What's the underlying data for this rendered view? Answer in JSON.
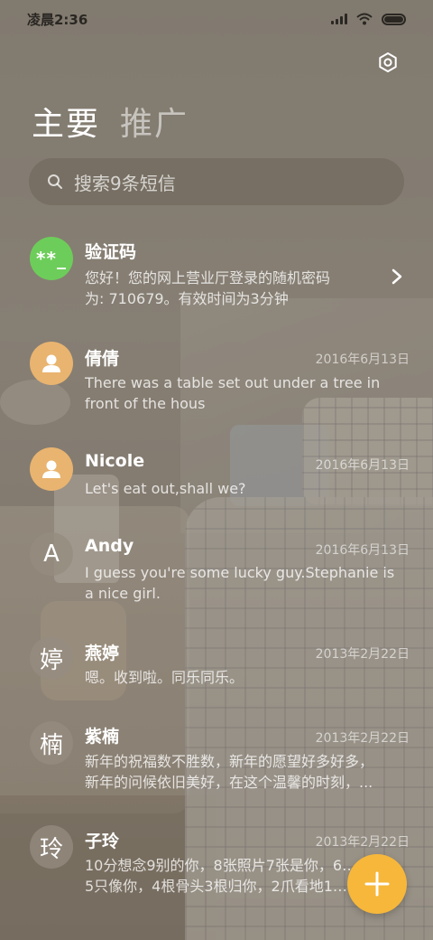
{
  "status_bar": {
    "time": "凌晨2:36"
  },
  "tabs": [
    {
      "label": "主要",
      "active": true
    },
    {
      "label": "推广",
      "active": false
    }
  ],
  "search": {
    "placeholder": "搜索9条短信"
  },
  "messages": [
    {
      "sender": "验证码",
      "avatar": "**_",
      "avatar_color": "#6dcd5a",
      "date": "",
      "preview_line1": "您好！您的网上营业厅登录的随机密码",
      "preview_line2": "为: 710679。有效时间为3分钟"
    },
    {
      "sender": "倩倩",
      "avatar": "person-icon",
      "avatar_color": "#e9b470",
      "date": "2016年6月13日",
      "preview_line1": "There was a table set out under a tree in",
      "preview_line2": "front of the hous"
    },
    {
      "sender": "Nicole",
      "avatar": "person-icon",
      "avatar_color": "#e9b470",
      "date": "2016年6月13日",
      "preview_line1": "Let's eat out,shall we?",
      "preview_line2": ""
    },
    {
      "sender": "Andy",
      "avatar": "A",
      "avatar_color": "",
      "date": "2016年6月13日",
      "preview_line1": "I guess you're some lucky guy.Stephanie is",
      "preview_line2": "a nice girl."
    },
    {
      "sender": "燕婷",
      "avatar": "婷",
      "avatar_color": "",
      "date": "2013年2月22日",
      "preview_line1": "嗯。收到啦。同乐同乐。",
      "preview_line2": ""
    },
    {
      "sender": "紫楠",
      "avatar": "楠",
      "avatar_color": "",
      "date": "2013年2月22日",
      "preview_line1": "新年的祝福数不胜数，新年的愿望好多好多，",
      "preview_line2": "新年的问候依旧美好，在这个温馨的时刻，..."
    },
    {
      "sender": "子玲",
      "avatar": "玲",
      "avatar_color": "",
      "date": "2013年2月22日",
      "preview_line1": "10分想念9别的你，8张照片7张是你，6…",
      "preview_line2": "5只像你，4根骨头3根归你，2爪看地1…"
    }
  ],
  "colors": {
    "fab": "#f6b73a",
    "code_avatar": "#6dcd5a",
    "contact_avatar": "#e9b470"
  }
}
